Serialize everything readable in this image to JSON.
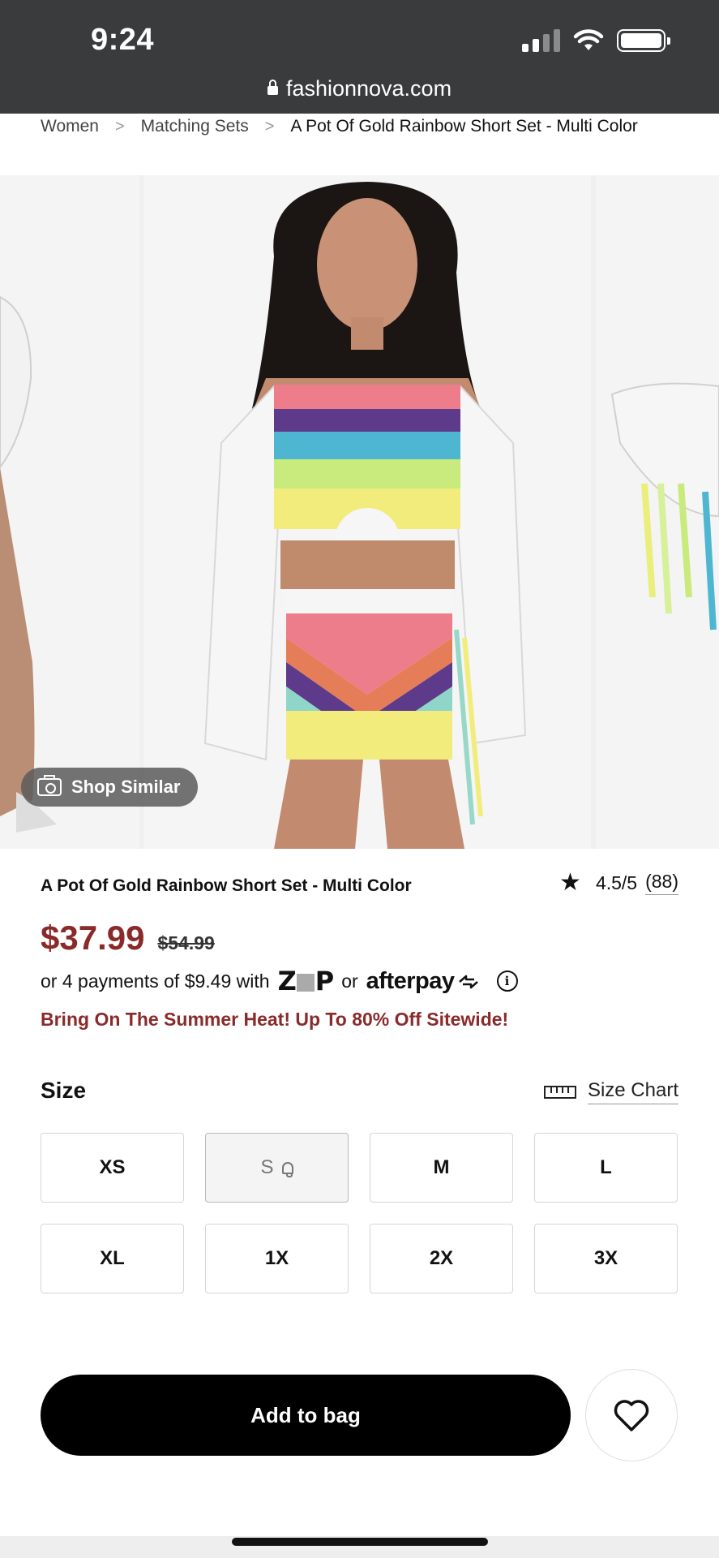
{
  "status_bar": {
    "time": "9:24"
  },
  "browser": {
    "url": "fashionnova.com"
  },
  "breadcrumb": {
    "items": [
      "Women",
      "Matching Sets",
      "A Pot Of Gold Rainbow Short Set - Multi Color"
    ],
    "separator": ">"
  },
  "gallery": {
    "shop_similar_label": "Shop Similar"
  },
  "product": {
    "title": "A Pot Of Gold Rainbow Short Set - Multi Color",
    "rating": "4.5/5",
    "review_count": "(88)",
    "price": "$37.99",
    "original_price": "$54.99",
    "payments_prefix": "or 4 payments of $9.49 with",
    "payments_or": "or",
    "zip_logo": "ZIP",
    "afterpay_logo": "afterpay",
    "promo": "Bring On The Summer Heat! Up To 80% Off Sitewide!"
  },
  "size_section": {
    "label": "Size",
    "chart_label": "Size Chart",
    "sizes": [
      "XS",
      "S",
      "M",
      "L",
      "XL",
      "1X",
      "2X",
      "3X"
    ],
    "out_of_stock": [
      "S"
    ]
  },
  "actions": {
    "add_to_bag": "Add to bag"
  },
  "colors": {
    "sale_price": "#8b2a2a",
    "cta_background": "#000000",
    "status_bar": "#3a3b3d"
  }
}
